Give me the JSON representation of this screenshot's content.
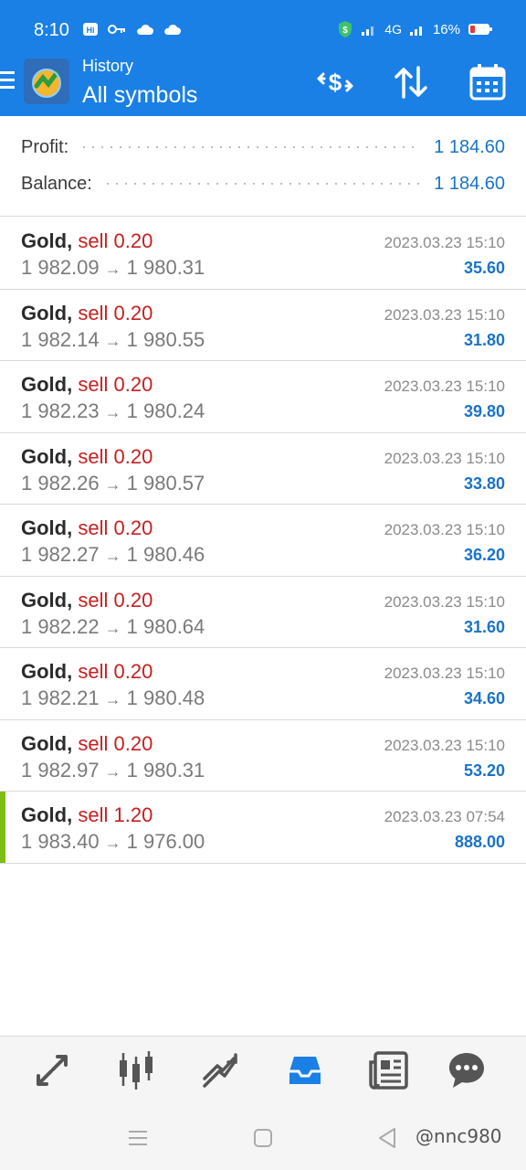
{
  "status_bar": {
    "time": "8:10",
    "network": "4G",
    "battery": "16%"
  },
  "header": {
    "kicker": "History",
    "title": "All symbols"
  },
  "summary": {
    "profit_label": "Profit:",
    "profit_value": "1 184.60",
    "balance_label": "Balance:",
    "balance_value": "1 184.60"
  },
  "deals": [
    {
      "symbol": "Gold",
      "comma": ",",
      "side": "sell",
      "volume": "0.20",
      "open": "1 982.09",
      "close": "1 980.31",
      "time": "2023.03.23 15:10",
      "profit": "35.60"
    },
    {
      "symbol": "Gold",
      "comma": ",",
      "side": "sell",
      "volume": "0.20",
      "open": "1 982.14",
      "close": "1 980.55",
      "time": "2023.03.23 15:10",
      "profit": "31.80"
    },
    {
      "symbol": "Gold",
      "comma": ",",
      "side": "sell",
      "volume": "0.20",
      "open": "1 982.23",
      "close": "1 980.24",
      "time": "2023.03.23 15:10",
      "profit": "39.80"
    },
    {
      "symbol": "Gold",
      "comma": ",",
      "side": "sell",
      "volume": "0.20",
      "open": "1 982.26",
      "close": "1 980.57",
      "time": "2023.03.23 15:10",
      "profit": "33.80"
    },
    {
      "symbol": "Gold",
      "comma": ",",
      "side": "sell",
      "volume": "0.20",
      "open": "1 982.27",
      "close": "1 980.46",
      "time": "2023.03.23 15:10",
      "profit": "36.20"
    },
    {
      "symbol": "Gold",
      "comma": ",",
      "side": "sell",
      "volume": "0.20",
      "open": "1 982.22",
      "close": "1 980.64",
      "time": "2023.03.23 15:10",
      "profit": "31.60"
    },
    {
      "symbol": "Gold",
      "comma": ",",
      "side": "sell",
      "volume": "0.20",
      "open": "1 982.21",
      "close": "1 980.48",
      "time": "2023.03.23 15:10",
      "profit": "34.60"
    },
    {
      "symbol": "Gold",
      "comma": ",",
      "side": "sell",
      "volume": "0.20",
      "open": "1 982.97",
      "close": "1 980.31",
      "time": "2023.03.23 15:10",
      "profit": "53.20"
    },
    {
      "symbol": "Gold",
      "comma": ",",
      "side": "sell",
      "volume": "1.20",
      "open": "1 983.40",
      "close": "1 976.00",
      "time": "2023.03.23 07:54",
      "profit": "888.00"
    }
  ],
  "arrow_glyph": "→",
  "tabs": [
    {
      "icon": "quotes-icon"
    },
    {
      "icon": "candlestick-chart-icon"
    },
    {
      "icon": "trade-icon"
    },
    {
      "icon": "history-inbox-icon",
      "active": true
    },
    {
      "icon": "news-icon"
    },
    {
      "icon": "chat-icon"
    }
  ],
  "watermark": "@nnc980",
  "colors": {
    "primary_blue": "#1a80e5",
    "sell_red": "#c62020",
    "profit_blue": "#1a73c9",
    "highlight_green": "#7cbf12"
  }
}
